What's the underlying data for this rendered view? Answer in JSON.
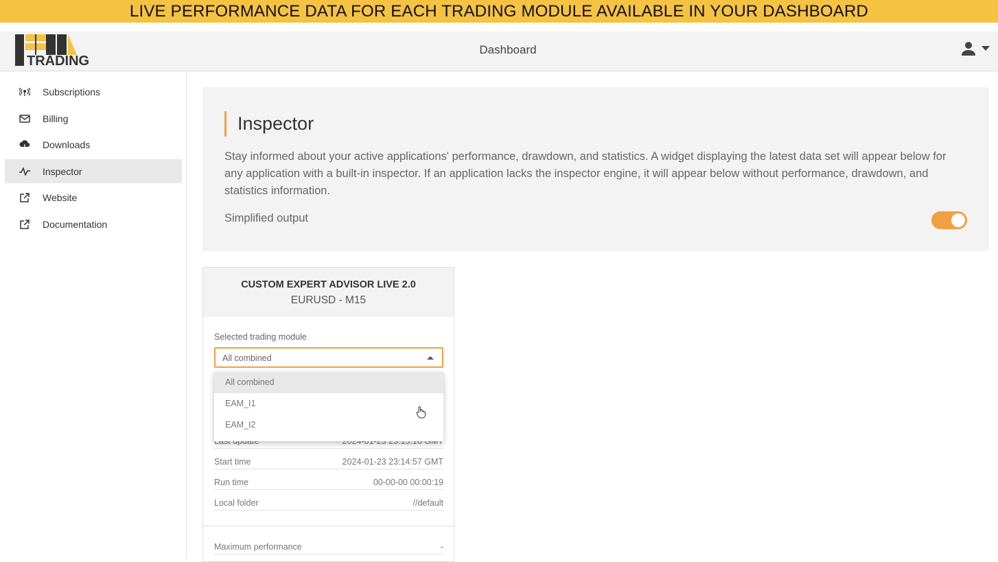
{
  "banner": "LIVE PERFORMANCE DATA FOR EACH TRADING MODULE AVAILABLE IN YOUR DASHBOARD",
  "header": {
    "logo_text": "TRADING",
    "title": "Dashboard",
    "user_icon": "user-icon"
  },
  "sidebar": {
    "items": [
      {
        "label": "Subscriptions",
        "icon": "broadcast-icon"
      },
      {
        "label": "Billing",
        "icon": "mail-icon"
      },
      {
        "label": "Downloads",
        "icon": "cloud-download-icon"
      },
      {
        "label": "Inspector",
        "icon": "pulse-icon",
        "active": true
      },
      {
        "label": "Website",
        "icon": "external-link-icon"
      },
      {
        "label": "Documentation",
        "icon": "external-link-icon"
      }
    ]
  },
  "inspector": {
    "title": "Inspector",
    "description": "Stay informed about your active applications' performance, drawdown, and statistics. A widget displaying the latest data set will appear below for any application with a built-in inspector. If an application lacks the inspector engine, it will appear below without performance, drawdown, and statistics information.",
    "simplified_label": "Simplified output",
    "simplified_on": true,
    "accent": "#f0a040"
  },
  "card": {
    "title": "CUSTOM EXPERT ADVISOR LIVE 2.0",
    "subtitle": "EURUSD - M15",
    "module_label": "Selected trading module",
    "module_value": "All combined",
    "options": [
      "All combined",
      "EAM_I1",
      "EAM_I2"
    ],
    "rows": [
      {
        "label": "Last update",
        "value": "2024-01-23 23:15:16 GMT"
      },
      {
        "label": "Start time",
        "value": "2024-01-23 23:14:57 GMT"
      },
      {
        "label": "Run time",
        "value": "00-00-00 00:00:19"
      },
      {
        "label": "Local folder",
        "value": "//default"
      }
    ],
    "stats": [
      {
        "label": "Maximum performance",
        "value": "-"
      }
    ]
  }
}
